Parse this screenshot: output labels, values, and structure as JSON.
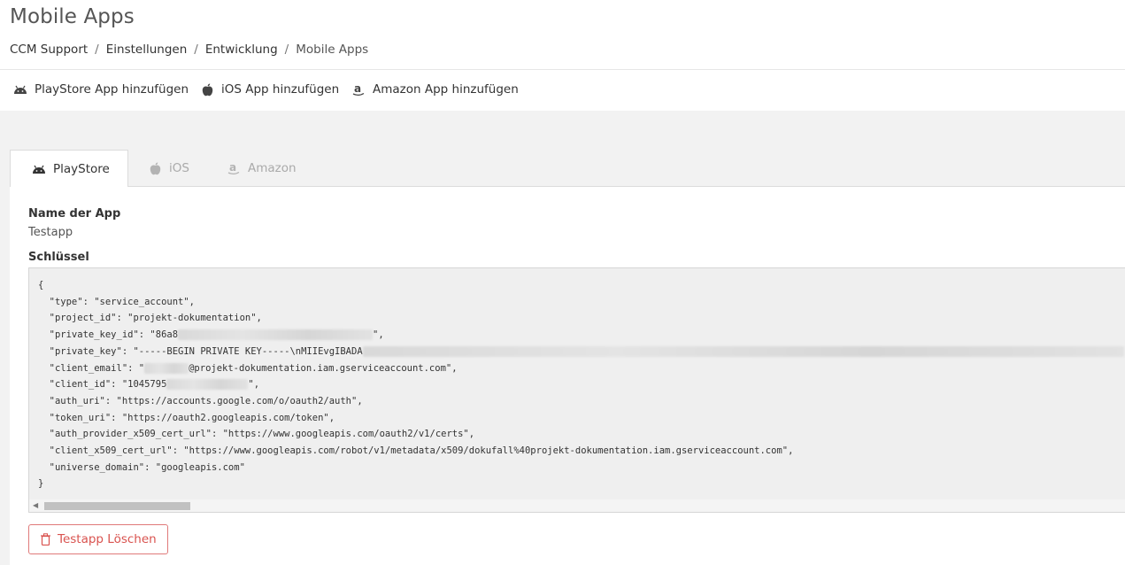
{
  "header": {
    "title": "Mobile Apps",
    "breadcrumb": [
      "CCM Support",
      "Einstellungen",
      "Entwicklung",
      "Mobile Apps"
    ],
    "breadcrumb_sep": "/"
  },
  "actions": {
    "playstore": {
      "label": "PlayStore App hinzufügen",
      "icon": "android-icon"
    },
    "ios": {
      "label": "iOS App hinzufügen",
      "icon": "apple-icon"
    },
    "amazon": {
      "label": "Amazon App hinzufügen",
      "icon": "amazon-icon"
    }
  },
  "tabs": [
    {
      "label": "PlayStore",
      "icon": "android-icon",
      "active": true
    },
    {
      "label": "iOS",
      "icon": "apple-icon",
      "active": false
    },
    {
      "label": "Amazon",
      "icon": "amazon-icon",
      "active": false
    }
  ],
  "app": {
    "name_label": "Name der App",
    "name_value": "Testapp",
    "key_label": "Schlüssel",
    "key_lines": [
      "{",
      "  \"type\": \"service_account\",",
      "  \"project_id\": \"projekt-dokumentation\",",
      "  \"private_key_id\": \"86a8",
      "  \"private_key\": \"-----BEGIN PRIVATE KEY-----\\nMIIEvgIBADA",
      "  \"client_email\": \"",
      "  \"client_id\": \"1045795",
      "  \"auth_uri\": \"https://accounts.google.com/o/oauth2/auth\",",
      "  \"token_uri\": \"https://oauth2.googleapis.com/token\",",
      "  \"auth_provider_x509_cert_url\": \"https://www.googleapis.com/oauth2/v1/certs\",",
      "  \"client_x509_cert_url\": \"https://www.googleapis.com/robot/v1/metadata/x509/dokufall%40projekt-dokumentation.iam.gserviceaccount.com\",",
      "  \"universe_domain\": \"googleapis.com\"",
      "}"
    ],
    "key_tails": {
      "private_key_id": "\",",
      "client_email": "@projekt-dokumentation.iam.gserviceaccount.com\",",
      "client_id": "\","
    },
    "delete_label": "Testapp Löschen"
  },
  "colors": {
    "danger": "#d9534f",
    "muted_bg": "#f2f2f2"
  }
}
